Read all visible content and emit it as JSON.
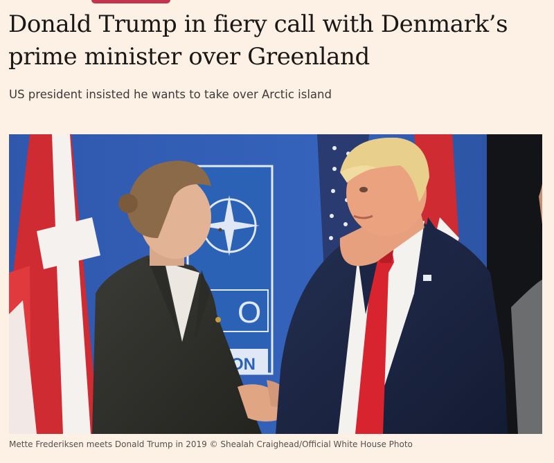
{
  "article": {
    "headline": "Donald Trump in fiery call with Denmark’s prime minister over Greenland",
    "standfirst": "US president insisted he wants to take over Arctic island"
  },
  "image": {
    "caption": "Mette Frederiksen meets Donald Trump in 2019 © Shealah Craighead/Official White House Photo",
    "banner_text_1": "O",
    "banner_text_2": "ON"
  },
  "colors": {
    "background": "#fdf0e4",
    "accent": "#c3354f",
    "backdrop_blue": "#2b4d9e",
    "danish_red": "#cf2b33"
  }
}
